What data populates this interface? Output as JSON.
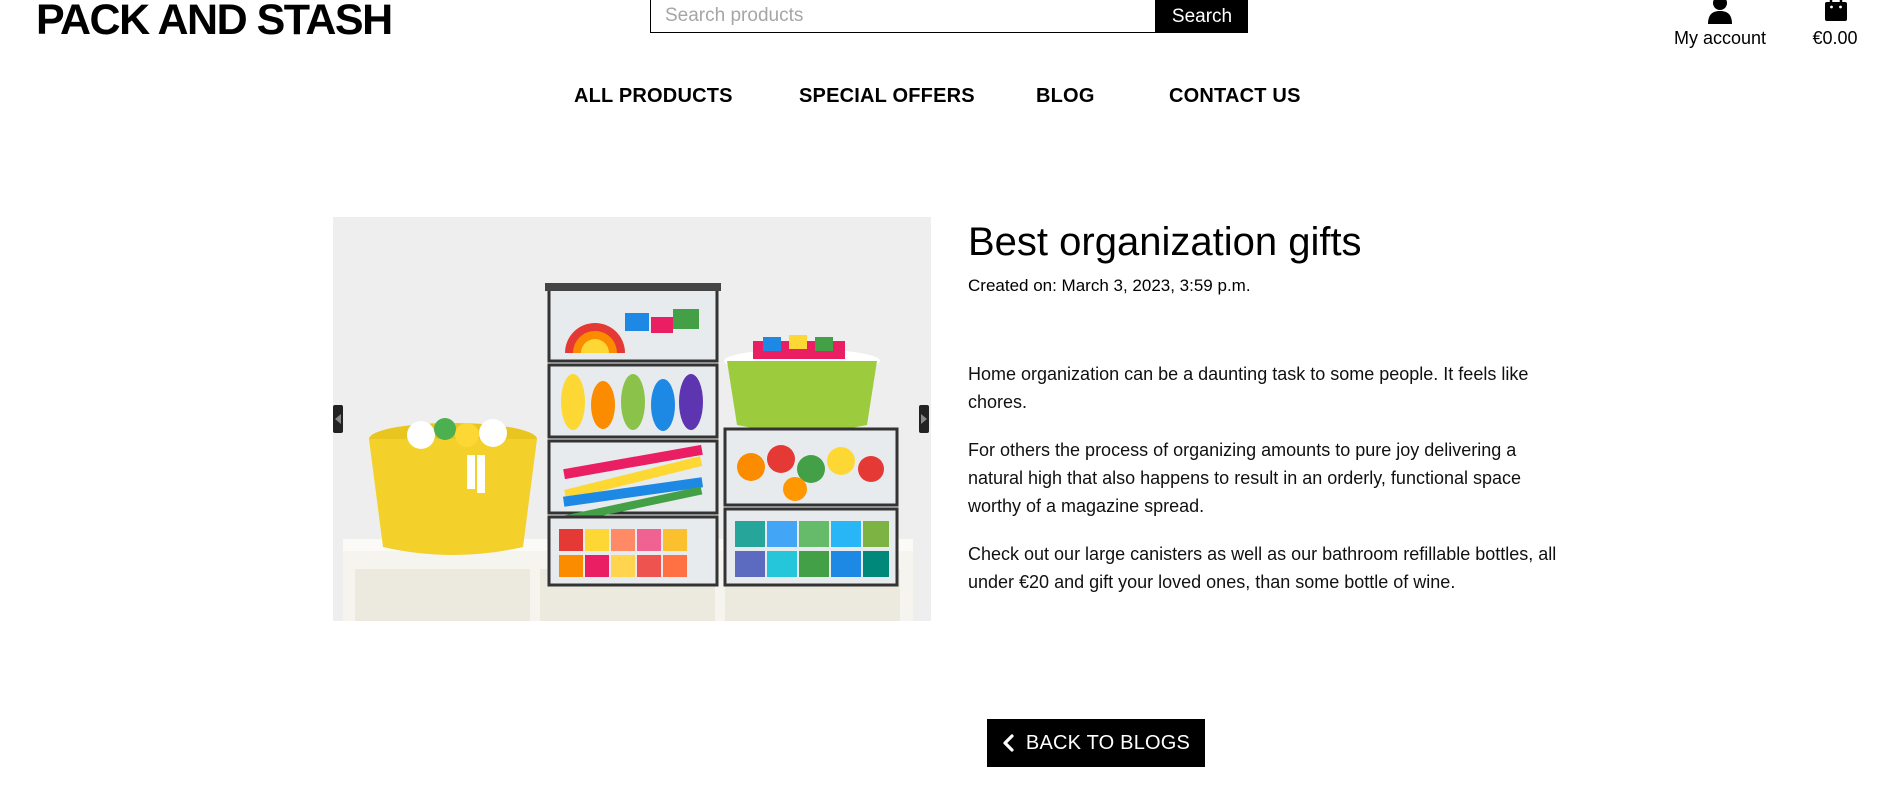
{
  "header": {
    "brand": "PACK AND STASH",
    "search_placeholder": "Search products",
    "search_button": "Search",
    "account_label": "My account",
    "cart_total": "€0.00"
  },
  "nav": {
    "items": [
      "ALL PRODUCTS",
      "SPECIAL OFFERS",
      "BLOG",
      "CONTACT US"
    ]
  },
  "icons": {
    "account": "user-icon",
    "cart": "shopping-bag-icon",
    "back": "chevron-left-icon",
    "carousel_prev": "caret-left-icon",
    "carousel_next": "caret-right-icon"
  },
  "post": {
    "title": "Best organization gifts",
    "created": "Created on: March 3, 2023, 3:59 p.m.",
    "paragraphs": [
      "Home organization can be a daunting task to some people. It feels like chores.",
      "For others the process of organizing amounts to pure joy delivering a natural high that also happens to result in an orderly, functional space worthy of a magazine spread.",
      "Check out our large canisters as well as our bathroom refillable bottles, all under €20 and gift your loved ones, than some bottle of wine."
    ]
  },
  "back_button": "BACK TO BLOGS"
}
